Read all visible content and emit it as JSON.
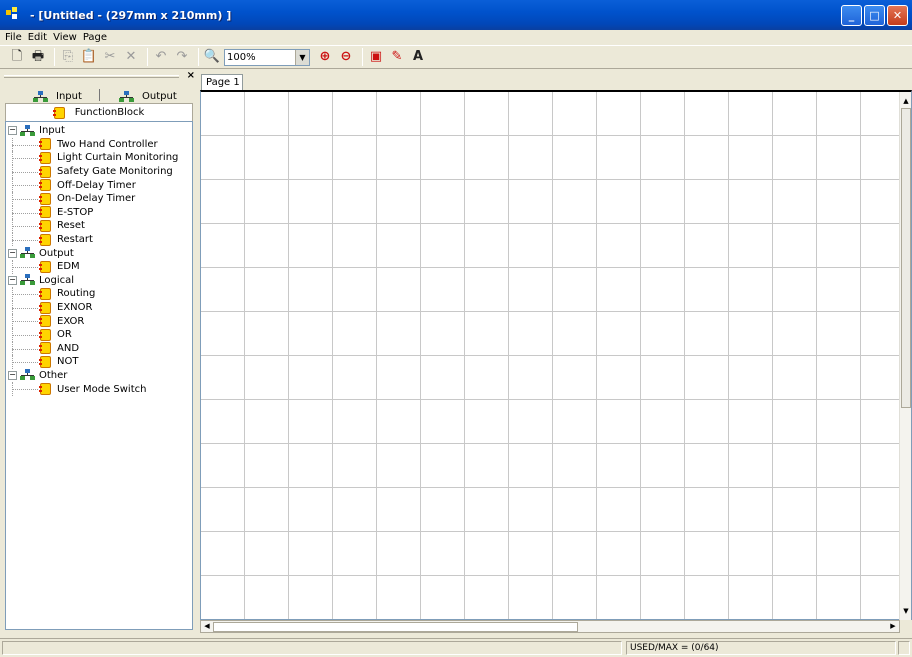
{
  "window": {
    "title": " - [Untitled - (297mm x 210mm) ]",
    "controls": {
      "minimize": "_",
      "maximize": "□",
      "close": "✕"
    }
  },
  "menu": [
    {
      "label": "File"
    },
    {
      "label": "Edit"
    },
    {
      "label": "View"
    },
    {
      "label": "Page"
    }
  ],
  "toolbar": {
    "zoom": "100%",
    "text_tool": "A"
  },
  "left_panel": {
    "close": "×",
    "tabs": {
      "input": "Input",
      "output": "Output",
      "function_block": "FunctionBlock"
    },
    "tree": [
      {
        "label": "Input",
        "children": [
          "Two Hand Controller",
          "Light Curtain Monitoring",
          "Safety Gate Monitoring",
          "Off-Delay Timer",
          "On-Delay Timer",
          "E-STOP",
          "Reset",
          "Restart"
        ]
      },
      {
        "label": "Output",
        "children": [
          "EDM"
        ]
      },
      {
        "label": "Logical",
        "children": [
          "Routing",
          "EXNOR",
          "EXOR",
          "OR",
          "AND",
          "NOT"
        ]
      },
      {
        "label": "Other",
        "children": [
          "User Mode Switch"
        ]
      }
    ]
  },
  "canvas": {
    "page_tab": "Page 1"
  },
  "status": {
    "used_max": "USED/MAX = (0/64)"
  }
}
